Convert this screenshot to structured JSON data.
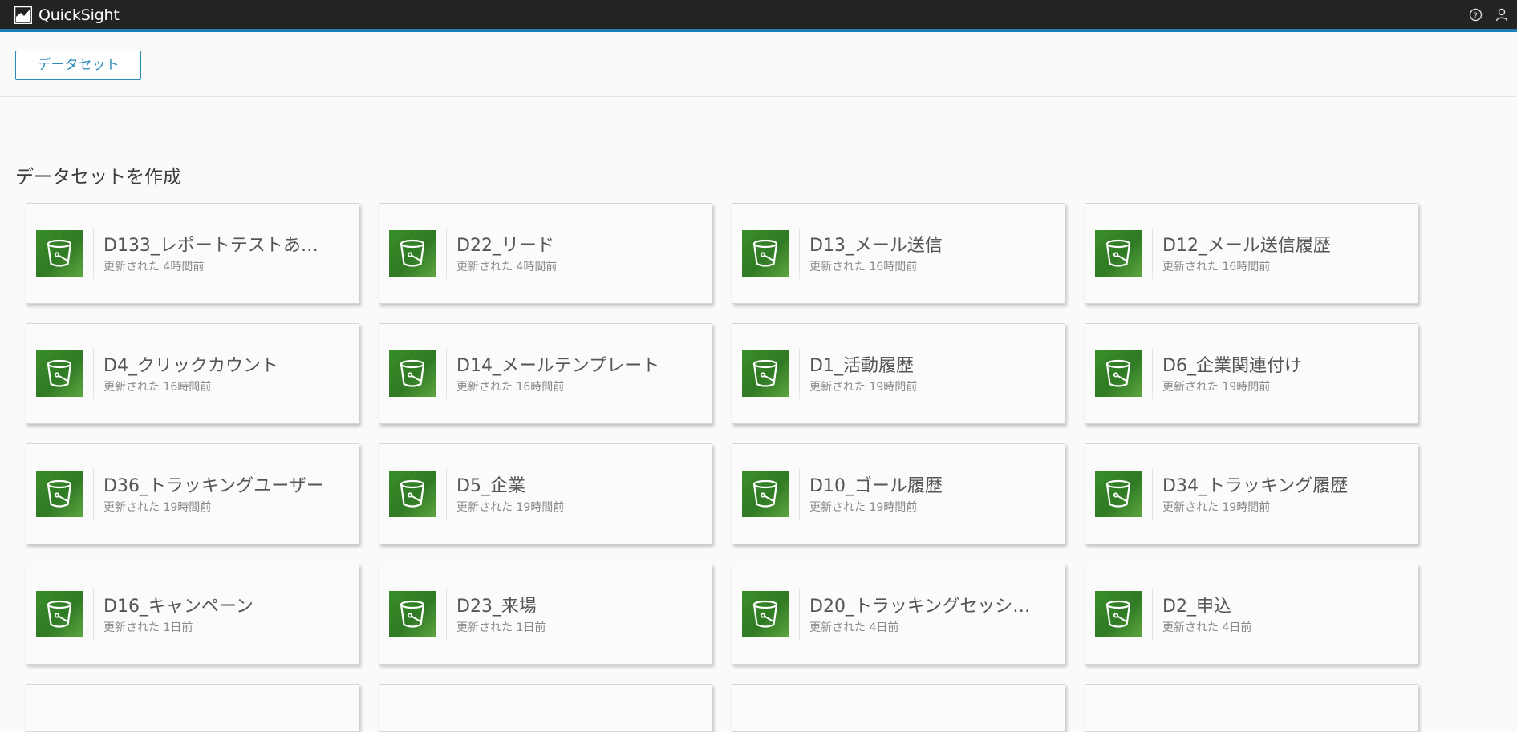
{
  "app": {
    "name": "QuickSight"
  },
  "header": {
    "icons": [
      "help-icon",
      "user-icon"
    ]
  },
  "toolbar": {
    "dataset_button": "データセット"
  },
  "section": {
    "title": "データセットを作成"
  },
  "datasets": [
    {
      "title": "D133_レポートテストあ…",
      "updated": "更新された 4時間前"
    },
    {
      "title": "D22_リード",
      "updated": "更新された 4時間前"
    },
    {
      "title": "D13_メール送信",
      "updated": "更新された 16時間前"
    },
    {
      "title": "D12_メール送信履歴",
      "updated": "更新された 16時間前"
    },
    {
      "title": "D4_クリックカウント",
      "updated": "更新された 16時間前"
    },
    {
      "title": "D14_メールテンプレート",
      "updated": "更新された 16時間前"
    },
    {
      "title": "D1_活動履歴",
      "updated": "更新された 19時間前"
    },
    {
      "title": "D6_企業関連付け",
      "updated": "更新された 19時間前"
    },
    {
      "title": "D36_トラッキングユーザー",
      "updated": "更新された 19時間前"
    },
    {
      "title": "D5_企業",
      "updated": "更新された 19時間前"
    },
    {
      "title": "D10_ゴール履歴",
      "updated": "更新された 19時間前"
    },
    {
      "title": "D34_トラッキング履歴",
      "updated": "更新された 19時間前"
    },
    {
      "title": "D16_キャンペーン",
      "updated": "更新された 1日前"
    },
    {
      "title": "D23_来場",
      "updated": "更新された 1日前"
    },
    {
      "title": "D20_トラッキングセッシ…",
      "updated": "更新された 4日前"
    },
    {
      "title": "D2_申込",
      "updated": "更新された 4日前"
    }
  ],
  "icons": {
    "dataset": "s3-bucket-icon"
  },
  "colors": {
    "accent": "#1f7fb5",
    "icon_green": "#3a8e2a",
    "header_bg": "#232323"
  }
}
